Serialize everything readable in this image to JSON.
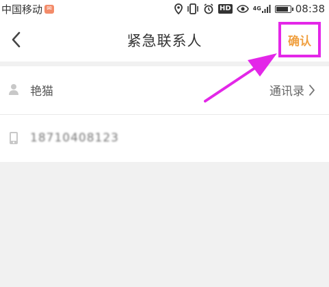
{
  "status_bar": {
    "carrier": "中国移动",
    "mail_badge": "✉",
    "hd_badge": "HD",
    "network_label": "4G",
    "time": "08:38",
    "battery_level": 0.9
  },
  "navbar": {
    "title": "紧急联系人",
    "confirm_label": "确认"
  },
  "form": {
    "name_value": "艳猫",
    "contacts_label": "通讯录",
    "phone_value": "18710408123"
  },
  "colors": {
    "accent": "#f0a040",
    "highlight": "#e327e8",
    "background": "#f1f1f1"
  }
}
